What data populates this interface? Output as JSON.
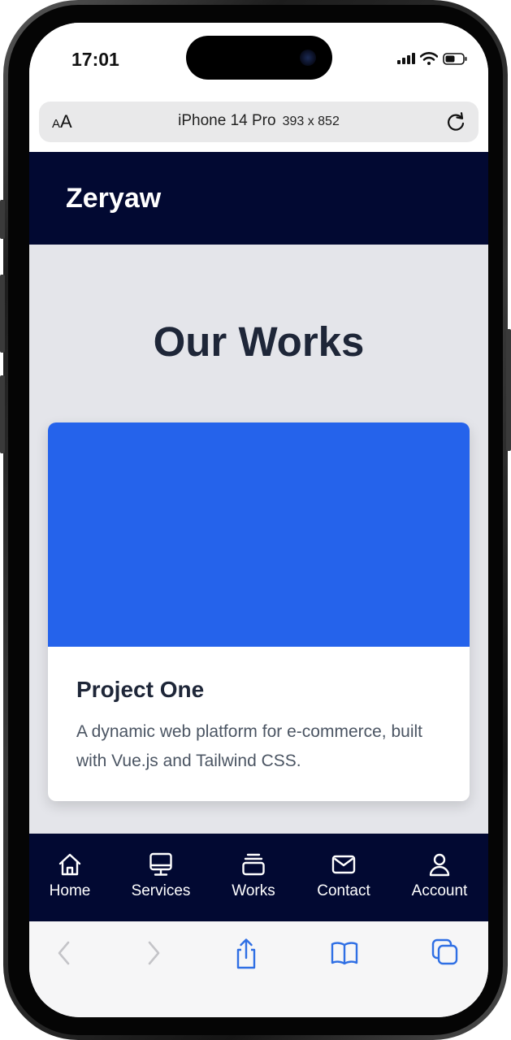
{
  "status_bar": {
    "time": "17:01"
  },
  "browser": {
    "aa_label_small": "A",
    "aa_label_large": "A",
    "device_name": "iPhone 14 Pro",
    "device_dims": "393 x 852"
  },
  "header": {
    "brand": "Zeryaw"
  },
  "main": {
    "title": "Our Works",
    "card": {
      "image_color": "#2563eb",
      "title": "Project One",
      "description": "A dynamic web platform for e-commerce, built with Vue.js and Tailwind CSS."
    }
  },
  "bottom_nav": {
    "items": [
      {
        "label": "Home",
        "icon": "home-icon"
      },
      {
        "label": "Services",
        "icon": "monitor-icon"
      },
      {
        "label": "Works",
        "icon": "stack-icon"
      },
      {
        "label": "Contact",
        "icon": "envelope-icon"
      },
      {
        "label": "Account",
        "icon": "user-icon"
      }
    ]
  },
  "safari_toolbar": {
    "icons": [
      "back-icon",
      "forward-icon",
      "share-icon",
      "bookmarks-icon",
      "tabs-icon"
    ]
  },
  "colors": {
    "header_bg": "#020932",
    "main_bg": "#e4e5ea",
    "accent": "#2563eb",
    "title_text": "#1e2638"
  }
}
